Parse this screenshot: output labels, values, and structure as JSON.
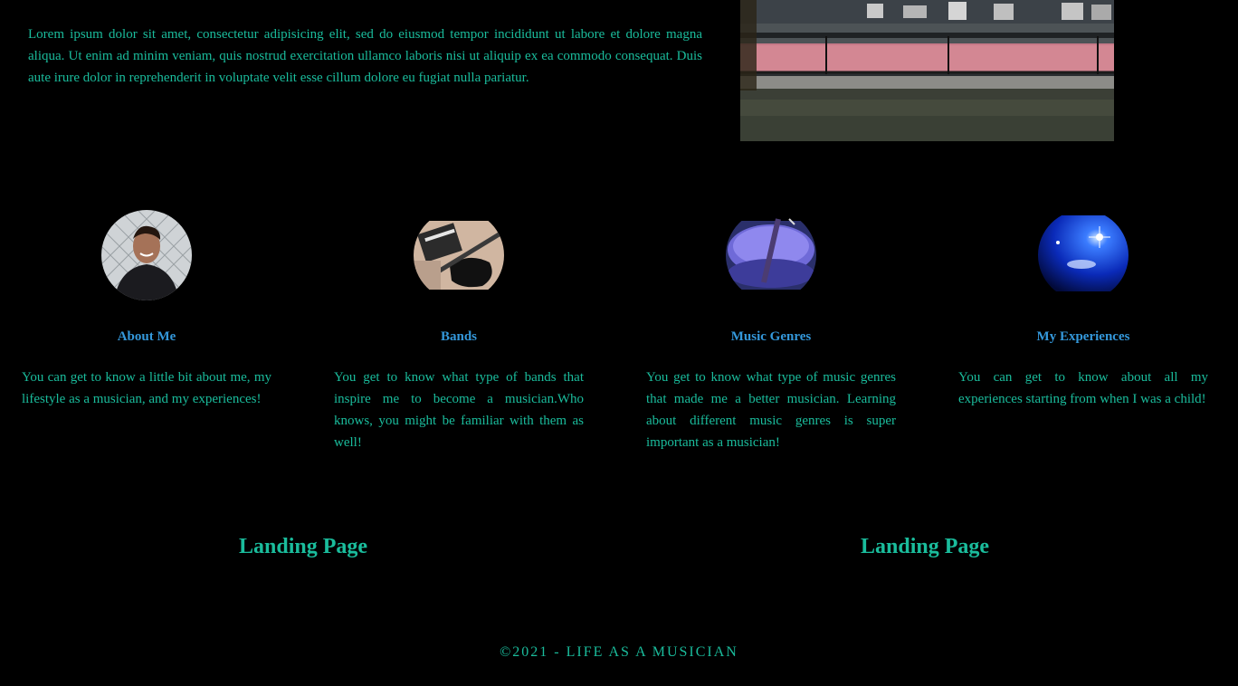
{
  "intro": {
    "text": "Lorem ipsum dolor sit amet, consectetur adipisicing elit, sed do eiusmod tempor incididunt ut labore et dolore magna aliqua. Ut enim ad minim veniam, quis nostrud exercitation ullamco laboris nisi ut aliquip ex ea commodo consequat. Duis aute irure dolor in reprehenderit in voluptate velit esse cillum dolore eu fugiat nulla pariatur."
  },
  "cards": [
    {
      "title": "About Me",
      "description": "You can get to know a little bit about me, my lifestyle as a musician, and my experiences!"
    },
    {
      "title": "Bands",
      "description": "You get to know what type of bands that inspire me to become a musician.Who knows, you might be familiar with them as well!"
    },
    {
      "title": "Music Genres",
      "description": "You get to know what type of music genres that made me a better musician. Learning about different music genres is super important as a musician!"
    },
    {
      "title": "My Experiences",
      "description": "You can get to know about all my experiences starting from when I was a child!"
    }
  ],
  "landing_links": [
    {
      "label": "Landing Page"
    },
    {
      "label": "Landing Page"
    }
  ],
  "footer": {
    "text": "©2021 - LIFE AS A MUSICIAN"
  },
  "colors": {
    "background": "#000000",
    "text": "#1abc9c",
    "heading": "#3498db"
  }
}
